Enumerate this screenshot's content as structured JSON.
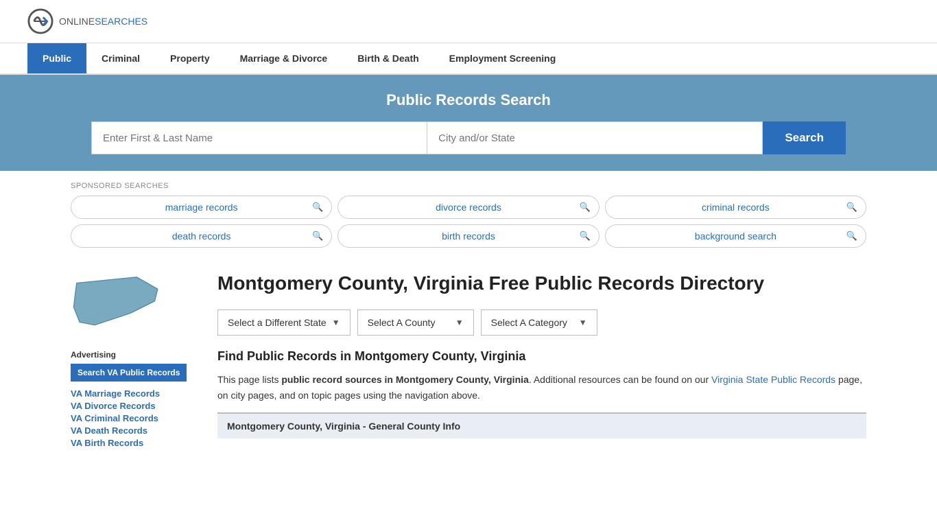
{
  "header": {
    "logo_online": "ONLINE",
    "logo_searches": "SEARCHES"
  },
  "nav": {
    "items": [
      {
        "label": "Public",
        "active": true
      },
      {
        "label": "Criminal",
        "active": false
      },
      {
        "label": "Property",
        "active": false
      },
      {
        "label": "Marriage & Divorce",
        "active": false
      },
      {
        "label": "Birth & Death",
        "active": false
      },
      {
        "label": "Employment Screening",
        "active": false
      }
    ]
  },
  "search_banner": {
    "title": "Public Records Search",
    "name_placeholder": "Enter First & Last Name",
    "location_placeholder": "City and/or State",
    "button_label": "Search"
  },
  "sponsored": {
    "label": "SPONSORED SEARCHES",
    "items": [
      "marriage records",
      "divorce records",
      "criminal records",
      "death records",
      "birth records",
      "background search"
    ]
  },
  "sidebar": {
    "advertising_label": "Advertising",
    "search_va_btn": "Search VA Public Records",
    "links": [
      "VA Marriage Records",
      "VA Divorce Records",
      "VA Criminal Records",
      "VA Death Records",
      "VA Birth Records"
    ]
  },
  "main": {
    "page_title": "Montgomery County, Virginia Free Public Records Directory",
    "dropdown_state": "Select a Different State",
    "dropdown_county": "Select A County",
    "dropdown_category": "Select A Category",
    "find_title": "Find Public Records in Montgomery County, Virginia",
    "find_text_before": "This page lists ",
    "find_text_bold": "public record sources in Montgomery County, Virginia",
    "find_text_mid": ". Additional resources can be found on our ",
    "find_link": "Virginia State Public Records",
    "find_text_after": " page, on city pages, and on topic pages using the navigation above.",
    "general_info_label": "Montgomery County, Virginia - General County Info"
  }
}
